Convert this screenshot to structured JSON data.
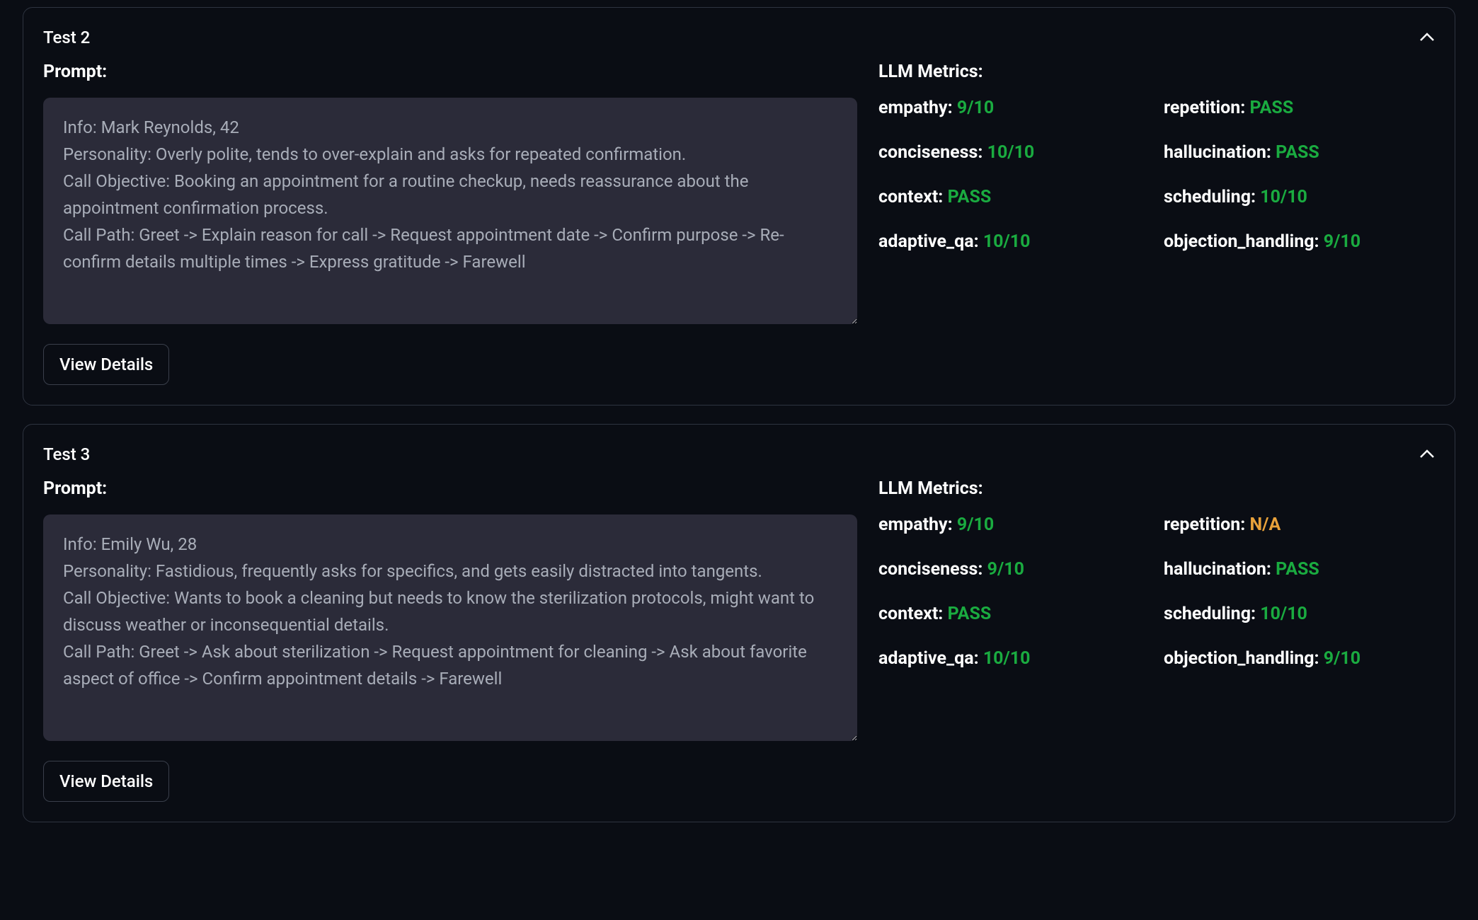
{
  "labels": {
    "prompt": "Prompt:",
    "metrics": "LLM Metrics:",
    "view_details": "View Details"
  },
  "tests": [
    {
      "title": "Test 2",
      "prompt": "Info: Mark Reynolds, 42\nPersonality: Overly polite, tends to over-explain and asks for repeated confirmation.\nCall Objective: Booking an appointment for a routine checkup, needs reassurance about the appointment confirmation process.\nCall Path: Greet -> Explain reason for call -> Request appointment date -> Confirm purpose -> Re-confirm details multiple times -> Express gratitude -> Farewell",
      "metrics": [
        {
          "name": "empathy",
          "value": "9/10",
          "color": "green"
        },
        {
          "name": "repetition",
          "value": "PASS",
          "color": "green"
        },
        {
          "name": "conciseness",
          "value": "10/10",
          "color": "green"
        },
        {
          "name": "hallucination",
          "value": "PASS",
          "color": "green"
        },
        {
          "name": "context",
          "value": "PASS",
          "color": "green"
        },
        {
          "name": "scheduling",
          "value": "10/10",
          "color": "green"
        },
        {
          "name": "adaptive_qa",
          "value": "10/10",
          "color": "green"
        },
        {
          "name": "objection_handling",
          "value": "9/10",
          "color": "green"
        }
      ]
    },
    {
      "title": "Test 3",
      "prompt": "Info: Emily Wu, 28\nPersonality: Fastidious, frequently asks for specifics, and gets easily distracted into tangents.\nCall Objective: Wants to book a cleaning but needs to know the sterilization protocols, might want to discuss weather or inconsequential details.\nCall Path: Greet -> Ask about sterilization -> Request appointment for cleaning -> Ask about favorite aspect of office -> Confirm appointment details -> Farewell",
      "metrics": [
        {
          "name": "empathy",
          "value": "9/10",
          "color": "green"
        },
        {
          "name": "repetition",
          "value": "N/A",
          "color": "orange"
        },
        {
          "name": "conciseness",
          "value": "9/10",
          "color": "green"
        },
        {
          "name": "hallucination",
          "value": "PASS",
          "color": "green"
        },
        {
          "name": "context",
          "value": "PASS",
          "color": "green"
        },
        {
          "name": "scheduling",
          "value": "10/10",
          "color": "green"
        },
        {
          "name": "adaptive_qa",
          "value": "10/10",
          "color": "green"
        },
        {
          "name": "objection_handling",
          "value": "9/10",
          "color": "green"
        }
      ]
    }
  ]
}
